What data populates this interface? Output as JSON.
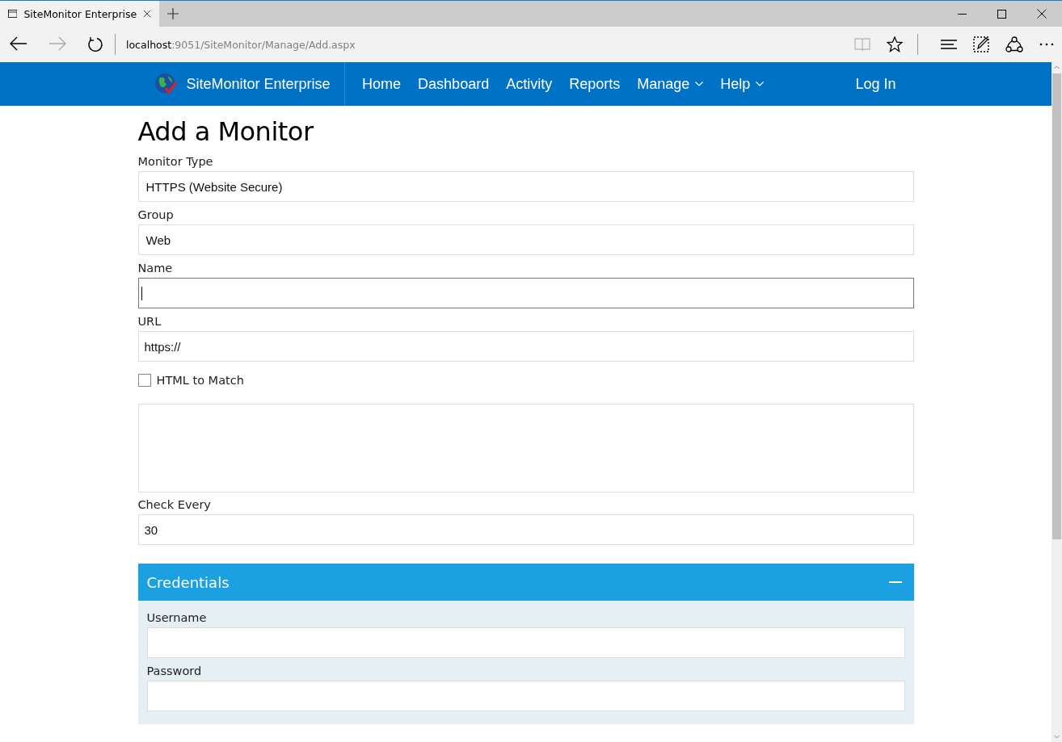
{
  "browser": {
    "tab_title": "SiteMonitor Enterprise",
    "address_host": "localhost",
    "address_path": ":9051/SiteMonitor/Manage/Add.aspx"
  },
  "navbar": {
    "brand": "SiteMonitor Enterprise",
    "items": [
      {
        "label": "Home",
        "kind": "link"
      },
      {
        "label": "Dashboard",
        "kind": "link"
      },
      {
        "label": "Activity",
        "kind": "link"
      },
      {
        "label": "Reports",
        "kind": "link"
      },
      {
        "label": "Manage",
        "kind": "dropdown"
      },
      {
        "label": "Help",
        "kind": "dropdown"
      }
    ],
    "login": "Log In"
  },
  "page": {
    "title": "Add a Monitor"
  },
  "fields": [
    {
      "kind": "select",
      "label": "Monitor Type",
      "value": "HTTPS (Website Secure)"
    },
    {
      "kind": "select",
      "label": "Group",
      "value": "Web"
    },
    {
      "kind": "text",
      "label": "Name",
      "focused": true
    },
    {
      "kind": "text",
      "label": "URL",
      "value": "https://",
      "focused": false
    },
    {
      "kind": "checkbox",
      "label": "HTML to Match",
      "checked": false
    },
    {
      "kind": "textarea"
    },
    {
      "kind": "text",
      "label": "Check Every",
      "value": "30",
      "focused": false
    }
  ],
  "credentials": {
    "title": "Credentials",
    "expanded": true,
    "fields": [
      {
        "label": "Username"
      },
      {
        "label": "Password"
      }
    ]
  }
}
